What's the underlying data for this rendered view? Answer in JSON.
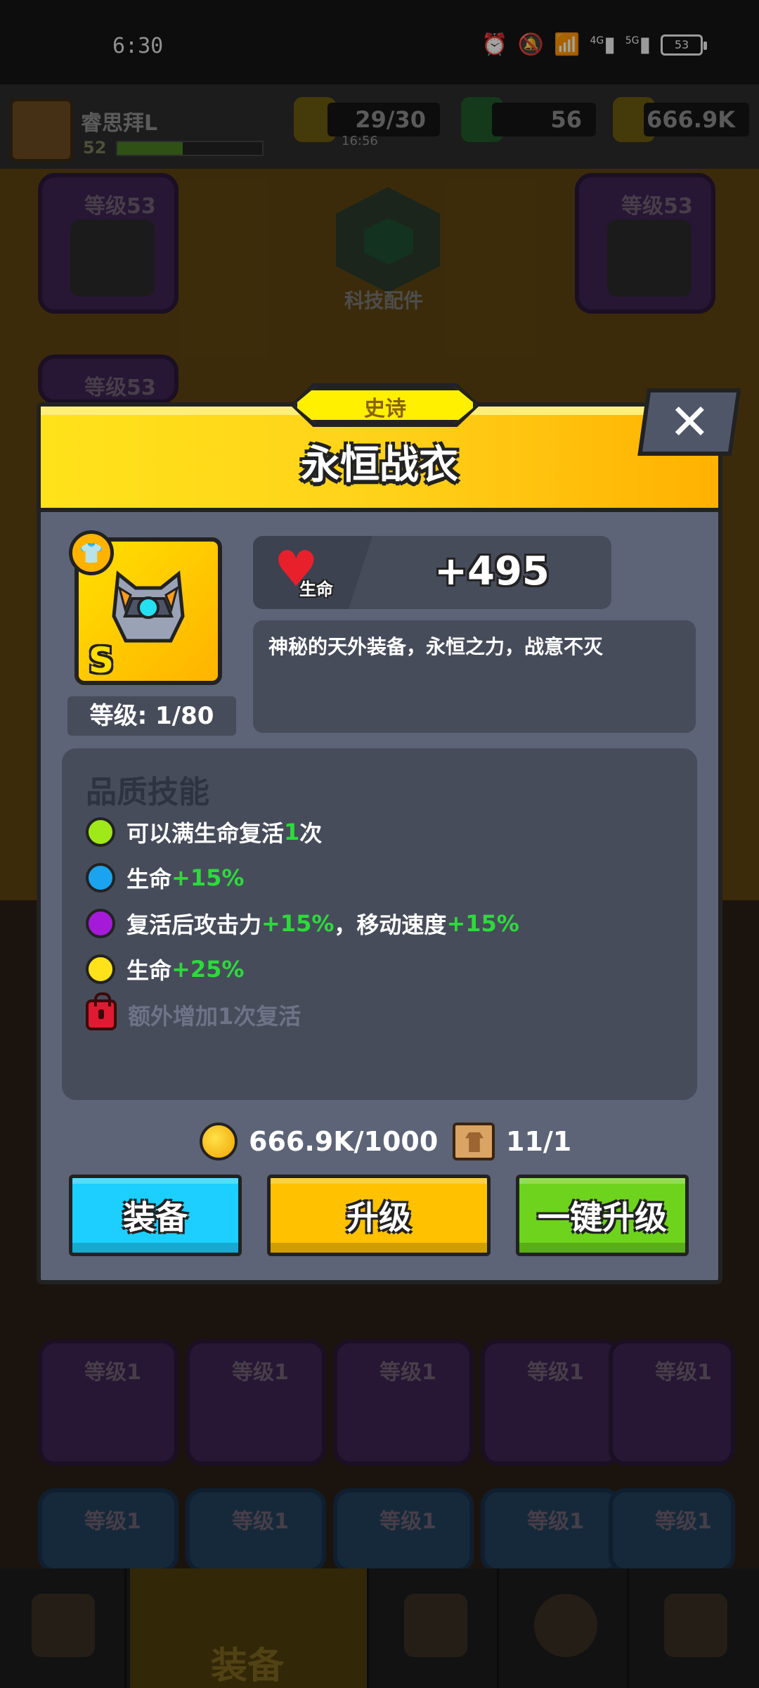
{
  "status_bar": {
    "time": "6:30",
    "net1": "4G",
    "net2": "5G",
    "battery": "53"
  },
  "player": {
    "name": "睿思拜L",
    "level": "52",
    "exp_fraction": 0.45
  },
  "resources": {
    "energy": "29/30",
    "energy_timer": "16:56",
    "gems": "56",
    "coins": "666.9K"
  },
  "background": {
    "slot_level_label": "等级53",
    "slot_level_low": "等级1",
    "slot_count": "2",
    "tech_label": "科技配件",
    "nav_active_label": "装备"
  },
  "modal": {
    "rarity": "史诗",
    "title": "永恒战衣",
    "close": "✕",
    "item_grade": "S",
    "item_level": "等级: 1/80",
    "stat_name": "生命",
    "stat_value": "+495",
    "description": "神秘的天外装备，永恒之力，战意不灭",
    "skills_title": "品质技能",
    "skills": [
      {
        "color": "#9fe81a",
        "text": "可以满生命复活",
        "value": "1",
        "suffix": "次"
      },
      {
        "color": "#1aa4f0",
        "text": "生命",
        "value": "+15%"
      },
      {
        "color": "#a51ad8",
        "text": "复活后攻击力",
        "value": "+15%",
        "mid": "，移动速度",
        "value2": "+15%"
      },
      {
        "color": "#ffe21a",
        "text": "生命",
        "value": "+25%"
      },
      {
        "locked": true,
        "text": "额外增加1次复活"
      }
    ],
    "cost_coins": "666.9K/1000",
    "cost_scrolls": "11/1",
    "buttons": {
      "equip": "装备",
      "upgrade": "升级",
      "upgrade_all": "一键升级"
    }
  }
}
